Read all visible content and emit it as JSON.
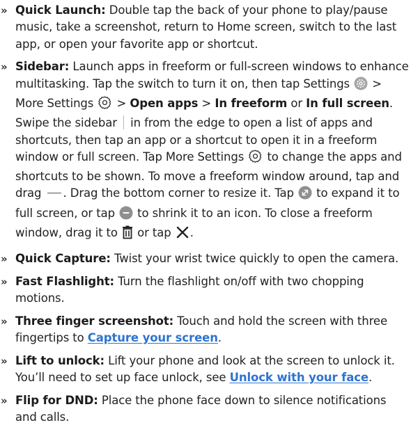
{
  "items": [
    {
      "title": "Quick Launch:",
      "text": "Double tap the back of your phone to play/pause music, take a screenshot, return to Home screen, switch to the last app, or open your favorite app or shortcut."
    },
    {
      "title": "Sidebar:",
      "t1": "Launch apps in freeform or full-screen windows to enhance multitasking. Tap the switch to turn it on, then tap Settings",
      "t2": "> More Settings",
      "t3": ">",
      "b1": "Open apps",
      "t4": ">",
      "b2": "In freeform",
      "t5": "or",
      "b3": "In full screen",
      "t6": ". Swipe the sidebar",
      "t7": "in from the edge to open a list of apps and shortcuts, then tap an app or a shortcut to open it in a freeform window or full screen. Tap More Settings",
      "t8": "to change the apps and shortcuts to be shown. To move a freeform window around, tap and drag",
      "t9": ". Drag the bottom corner to resize it. Tap",
      "t10": "to expand it to full screen, or tap",
      "t11": "to shrink it to an icon. To close a freeform window, drag it to",
      "t12": "or tap",
      "t13": "."
    },
    {
      "title": "Quick Capture:",
      "text": "Twist your wrist twice quickly to open the camera."
    },
    {
      "title": "Fast Flashlight:",
      "text": "Turn the flashlight on/off with two chopping motions."
    },
    {
      "title": "Three finger screenshot:",
      "text": "Touch and hold the screen with three fingertips to",
      "link": "Capture your screen",
      "end": "."
    },
    {
      "title": "Lift to unlock:",
      "text": "Lift your phone and look at the screen to unlock it. You’ll need to set up face unlock, see",
      "link": "Unlock with your face",
      "end": "."
    },
    {
      "title": "Flip for DND:",
      "text": "Place the phone face down to silence notifications and calls."
    }
  ],
  "bullet": "»",
  "colors": {
    "text": "#222222",
    "link": "#2f74d0",
    "icon_gray": "#8f8f8f"
  },
  "icons": [
    "settings-icon",
    "gear-icon",
    "sidebar-handle-icon",
    "drag-handle-icon",
    "expand-icon",
    "minimize-icon",
    "trash-icon",
    "close-icon"
  ]
}
